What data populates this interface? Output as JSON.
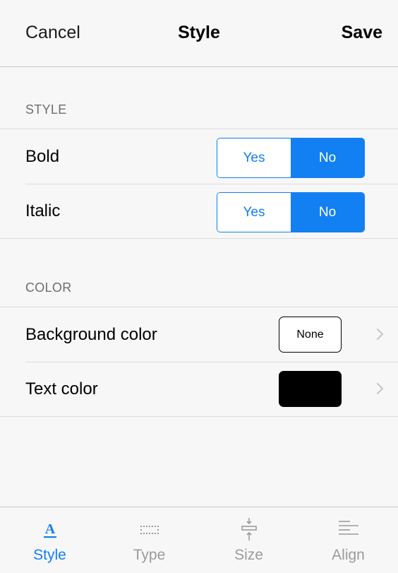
{
  "navbar": {
    "cancel_label": "Cancel",
    "title": "Style",
    "save_label": "Save"
  },
  "sections": {
    "style": {
      "header": "STYLE",
      "rows": [
        {
          "label": "Bold",
          "options": [
            "Yes",
            "No"
          ],
          "selected": "No"
        },
        {
          "label": "Italic",
          "options": [
            "Yes",
            "No"
          ],
          "selected": "No"
        }
      ]
    },
    "color": {
      "header": "COLOR",
      "rows": [
        {
          "label": "Background color",
          "value": "None",
          "swatch_color": "#ffffff"
        },
        {
          "label": "Text color",
          "swatch_color": "#000000"
        }
      ]
    }
  },
  "tabbar": {
    "tabs": [
      {
        "label": "Style",
        "icon": "font-style-icon",
        "active": true
      },
      {
        "label": "Type",
        "icon": "dotted-border-icon",
        "active": false
      },
      {
        "label": "Size",
        "icon": "size-icon",
        "active": false
      },
      {
        "label": "Align",
        "icon": "align-left-icon",
        "active": false
      }
    ]
  },
  "colors": {
    "accent": "#127ff3",
    "background": "#f7f7f7",
    "inactive_tab": "#9b9b9b",
    "section_header": "#6d6d72"
  }
}
